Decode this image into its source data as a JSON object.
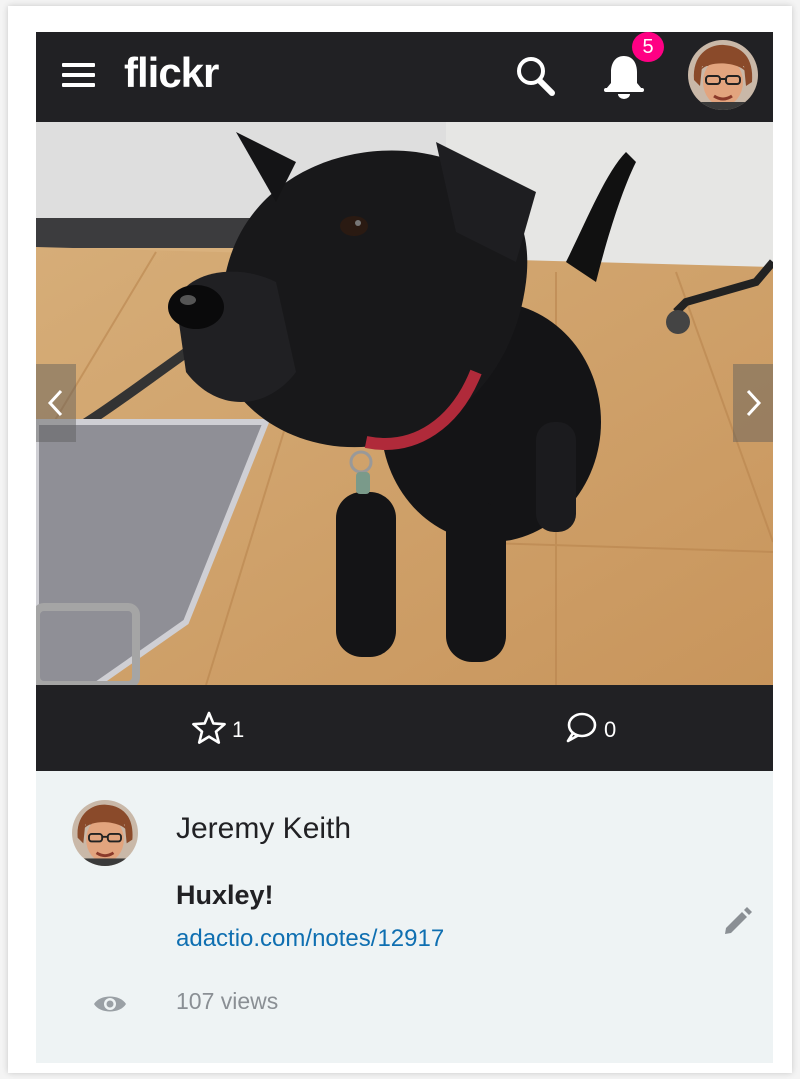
{
  "header": {
    "logo": "flickr",
    "notifications_count": "5"
  },
  "photo": {
    "subject": "black scruffy terrier dog with red collar standing on a wooden floor"
  },
  "stats": {
    "faves": "1",
    "comments": "0"
  },
  "info": {
    "owner_name": "Jeremy Keith",
    "title": "Huxley!",
    "link": "adactio.com/notes/12917",
    "views": "107 views"
  },
  "colors": {
    "bar": "#212124",
    "badge": "#ff0084",
    "link": "#0f6fb1",
    "panel": "#eef3f4"
  }
}
